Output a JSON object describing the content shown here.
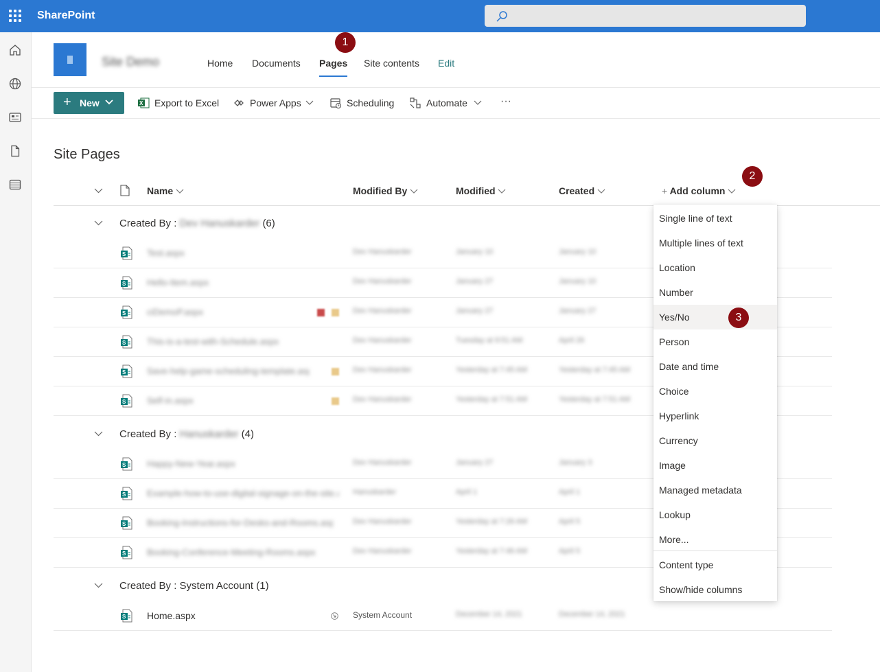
{
  "app": {
    "brand": "SharePoint"
  },
  "search": {
    "placeholder": ""
  },
  "site": {
    "name": "Site Demo",
    "nav": [
      {
        "label": "Home"
      },
      {
        "label": "Documents"
      },
      {
        "label": "Pages"
      },
      {
        "label": "Site contents"
      },
      {
        "label": "Edit"
      }
    ]
  },
  "toolbar": {
    "new_label": "New",
    "export_label": "Export to Excel",
    "powerapps_label": "Power Apps",
    "scheduling_label": "Scheduling",
    "automate_label": "Automate",
    "more_label": "···"
  },
  "page": {
    "title": "Site Pages"
  },
  "columns": {
    "name": "Name",
    "modified_by": "Modified By",
    "modified": "Modified",
    "created": "Created",
    "add_column": "Add column"
  },
  "groups": [
    {
      "prefix": "Created By : ",
      "author": "Dev Hanuskarder",
      "count": "(6)",
      "rows": [
        {
          "name": "Test.aspx",
          "modified_by": "Dev Hanuskarder",
          "modified": "January 10",
          "created": "January 10"
        },
        {
          "name": "Hello-Item.aspx",
          "modified_by": "Dev Hanuskarder",
          "modified": "January 27",
          "created": "January 10"
        },
        {
          "name": "ciDemoP.aspx",
          "modified_by": "Dev Hanuskarder",
          "modified": "January 27",
          "created": "January 27"
        },
        {
          "name": "This-is-a-test-with-Schedule.aspx",
          "modified_by": "Dev Hanuskarder",
          "modified": "Tuesday at 9:51 AM",
          "created": "April 26"
        },
        {
          "name": "Save-help-game-scheduling-template.aspx",
          "modified_by": "Dev Hanuskarder",
          "modified": "Yesterday at 7:45 AM",
          "created": "Yesterday at 7:45 AM"
        },
        {
          "name": "Self-in.aspx",
          "modified_by": "Dev Hanuskarder",
          "modified": "Yesterday at 7:51 AM",
          "created": "Yesterday at 7:51 AM"
        }
      ]
    },
    {
      "prefix": "Created By : ",
      "author": "Hanuskarder",
      "count": "(4)",
      "rows": [
        {
          "name": "Happy-New-Year.aspx",
          "modified_by": "Dev Hanuskarder",
          "modified": "January 27",
          "created": "January 3"
        },
        {
          "name": "Example-how-to-use-digital-signage-on-the-site.aspx",
          "modified_by": "Hanuskarder",
          "modified": "April 1",
          "created": "April 1"
        },
        {
          "name": "Booking-Instructions-for-Desks-and-Rooms.aspx",
          "modified_by": "Dev Hanuskarder",
          "modified": "Yesterday at 7:26 AM",
          "created": "April 5"
        },
        {
          "name": "Booking-Conference-Meeting-Rooms.aspx",
          "modified_by": "Dev Hanuskarder",
          "modified": "Yesterday at 7:46 AM",
          "created": "April 5"
        }
      ]
    },
    {
      "prefix": "Created By : ",
      "author": "System Account",
      "count": "(1)",
      "rows": [
        {
          "name": "Home.aspx",
          "modified_by": "System Account",
          "modified": "December 14, 2021",
          "created": "December 14, 2021"
        }
      ]
    }
  ],
  "menu": {
    "items": [
      "Single line of text",
      "Multiple lines of text",
      "Location",
      "Number",
      "Yes/No",
      "Person",
      "Date and time",
      "Choice",
      "Hyperlink",
      "Currency",
      "Image",
      "Managed metadata",
      "Lookup",
      "More..."
    ],
    "footer": [
      "Content type",
      "Show/hide columns"
    ]
  },
  "markers": [
    "1",
    "2",
    "3"
  ],
  "colors": {
    "suite_bar": "#2b78d2",
    "accent_teal": "#2b7b7f",
    "marker": "#8b0d12"
  }
}
